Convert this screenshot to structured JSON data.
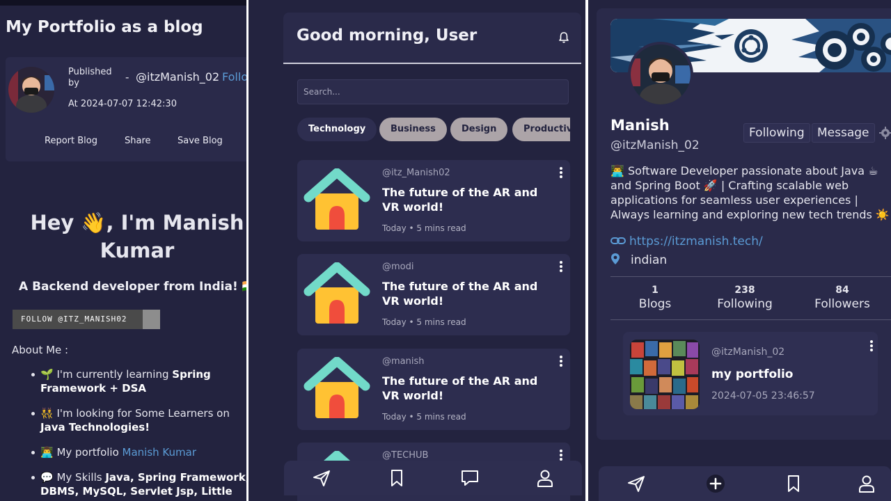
{
  "panel1": {
    "title": "My Portfolio as a blog",
    "published_by": "Published by",
    "dash": "-",
    "handle": "@itzManish_02",
    "follow_link": "Follow",
    "published_at": "At 2024-07-07 12:42:30",
    "actions": [
      "Report Blog",
      "Share",
      "Save Blog"
    ],
    "heading": "Hey 👋, I'm Manish Kumar",
    "subheading": "A Backend developer from India! 🇮🇳",
    "follow_button": "FOLLOW @ITZ_MANISH02",
    "about_title": "About Me :",
    "bullets": [
      {
        "emoji": "🌱",
        "text": " I'm currently learning ",
        "bold": "Spring Framework + DSA",
        "rest": ""
      },
      {
        "emoji": "👯",
        "text": " I'm looking for Some Learners on ",
        "bold": "Java Technologies!",
        "rest": ""
      },
      {
        "emoji": "👨‍💻",
        "text": " My portfolio ",
        "link": "Manish Kumar"
      },
      {
        "emoji": "💬",
        "text": " My Skills ",
        "bold": "Java, Spring Framework, DBMS, MySQL, Servlet Jsp, Little",
        "rest": ""
      }
    ]
  },
  "panel2": {
    "greeting": "Good morning, User",
    "search_placeholder": "Search...",
    "categories": [
      "Technology",
      "Business",
      "Design",
      "Productivity"
    ],
    "selected_category": "Technology",
    "posts": [
      {
        "user": "@itz_Manish02",
        "title": "The future of the AR and VR world!",
        "meta": "Today • 5 mins read"
      },
      {
        "user": "@modi",
        "title": "The future of the AR and VR world!",
        "meta": "Today • 5 mins read"
      },
      {
        "user": "@manish",
        "title": "The future of the AR and VR world!",
        "meta": "Today • 5 mins read"
      },
      {
        "user": "@TECHUB",
        "title": "",
        "meta": ""
      }
    ],
    "nav_icons": [
      "send-icon",
      "bookmark-icon",
      "chat-icon",
      "profile-icon"
    ]
  },
  "panel3": {
    "name": "Manish",
    "handle": "@itzManish_02",
    "following_button": "Following",
    "message_button": "Message",
    "bio": "👨‍💻 Software Developer passionate about Java ☕ and Spring Boot 🚀 | Crafting scalable web applications for seamless user experiences | Always learning and exploring new tech trends ☀️",
    "website": "https://itzmanish.tech/",
    "location": "indian",
    "stats": [
      {
        "value": "1",
        "label": "Blogs"
      },
      {
        "value": "238",
        "label": "Following"
      },
      {
        "value": "84",
        "label": "Followers"
      }
    ],
    "post": {
      "user": "@itzManish_02",
      "title": "my portfolio",
      "date": "2024-07-05 23:46:57"
    },
    "nav_icons": [
      "send-icon",
      "plus-icon",
      "bookmark-icon",
      "profile-icon"
    ]
  },
  "colors": {
    "background": "#23233f",
    "card": "#2d2d4f",
    "link": "#5b9bd5",
    "chip_unselected": "#aca4a8"
  }
}
